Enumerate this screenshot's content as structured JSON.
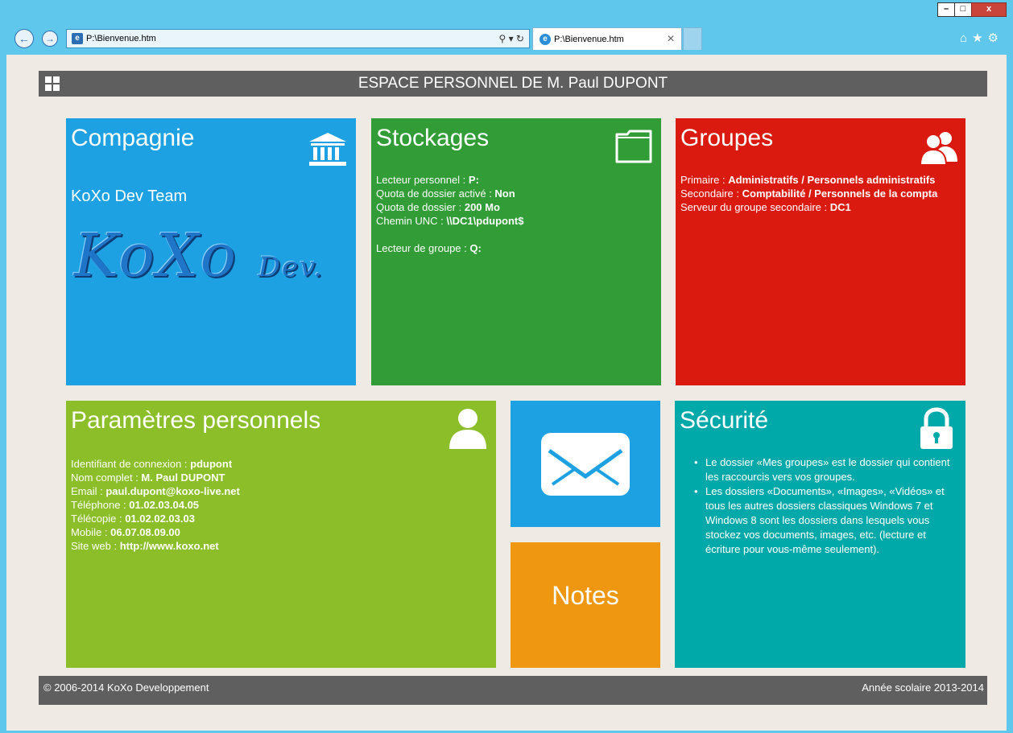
{
  "browser": {
    "address": "P:\\Bienvenue.htm",
    "tab_title": "P:\\Bienvenue.htm",
    "window_controls": [
      "–",
      "□",
      "x"
    ]
  },
  "header": {
    "prefix": "ESPACE PERSONNEL DE ",
    "name": "M. Paul DUPONT"
  },
  "compagnie": {
    "title": "Compagnie",
    "name": "KoXo Dev Team",
    "logo_text": "KoXo",
    "logo_sub": "Dev."
  },
  "stockages": {
    "title": "Stockages",
    "rows": [
      {
        "label": "Lecteur personnel : ",
        "value": "P:"
      },
      {
        "label": "Quota de dossier activé : ",
        "value": "Non"
      },
      {
        "label": "Quota de dossier : ",
        "value": "200 Mo"
      },
      {
        "label": "Chemin UNC : ",
        "value": "\\\\DC1\\pdupont$"
      },
      {
        "label": "Lecteur de groupe : ",
        "value": "Q:"
      }
    ]
  },
  "groupes": {
    "title": "Groupes",
    "rows": [
      {
        "label": "Primaire : ",
        "value": "Administratifs / Personnels administratifs"
      },
      {
        "label": "Secondaire : ",
        "value": "Comptabilité / Personnels de la compta"
      },
      {
        "label": "Serveur du groupe secondaire : ",
        "value": "DC1"
      }
    ]
  },
  "parametres": {
    "title": "Paramètres personnels",
    "rows": [
      {
        "label": "Identifiant de connexion : ",
        "value": "pdupont"
      },
      {
        "label": "Nom complet : ",
        "value": "M. Paul DUPONT"
      },
      {
        "label": "Email : ",
        "value": "paul.dupont@koxo-live.net"
      },
      {
        "label": "Téléphone : ",
        "value": "01.02.03.04.05"
      },
      {
        "label": "Télécopie : ",
        "value": "01.02.02.03.03"
      },
      {
        "label": "Mobile : ",
        "value": "06.07.08.09.00"
      },
      {
        "label": "Site web : ",
        "value": "http://www.koxo.net"
      }
    ]
  },
  "notes": {
    "title": "Notes"
  },
  "securite": {
    "title": "Sécurité",
    "items": [
      "Le dossier «Mes groupes» est le dossier qui contient les raccourcis vers vos groupes.",
      "Les dossiers «Documents», «Images», «Vidéos» et tous les autres dossiers classiques Windows 7 et Windows 8 sont les dossiers dans lesquels vous stockez vos documents, images, etc. (lecture et écriture pour vous-même seulement)."
    ]
  },
  "footer": {
    "left": "© 2006-2014 KoXo Developpement",
    "right": "Année scolaire 2013-2014"
  },
  "colors": {
    "blue": "#1ea1e2",
    "green": "#329c37",
    "red": "#da1a0f",
    "lime": "#8bbe28",
    "orange": "#f09712",
    "teal": "#00a9a9",
    "bar": "#5f5f5f",
    "page_bg": "#efeae4"
  }
}
